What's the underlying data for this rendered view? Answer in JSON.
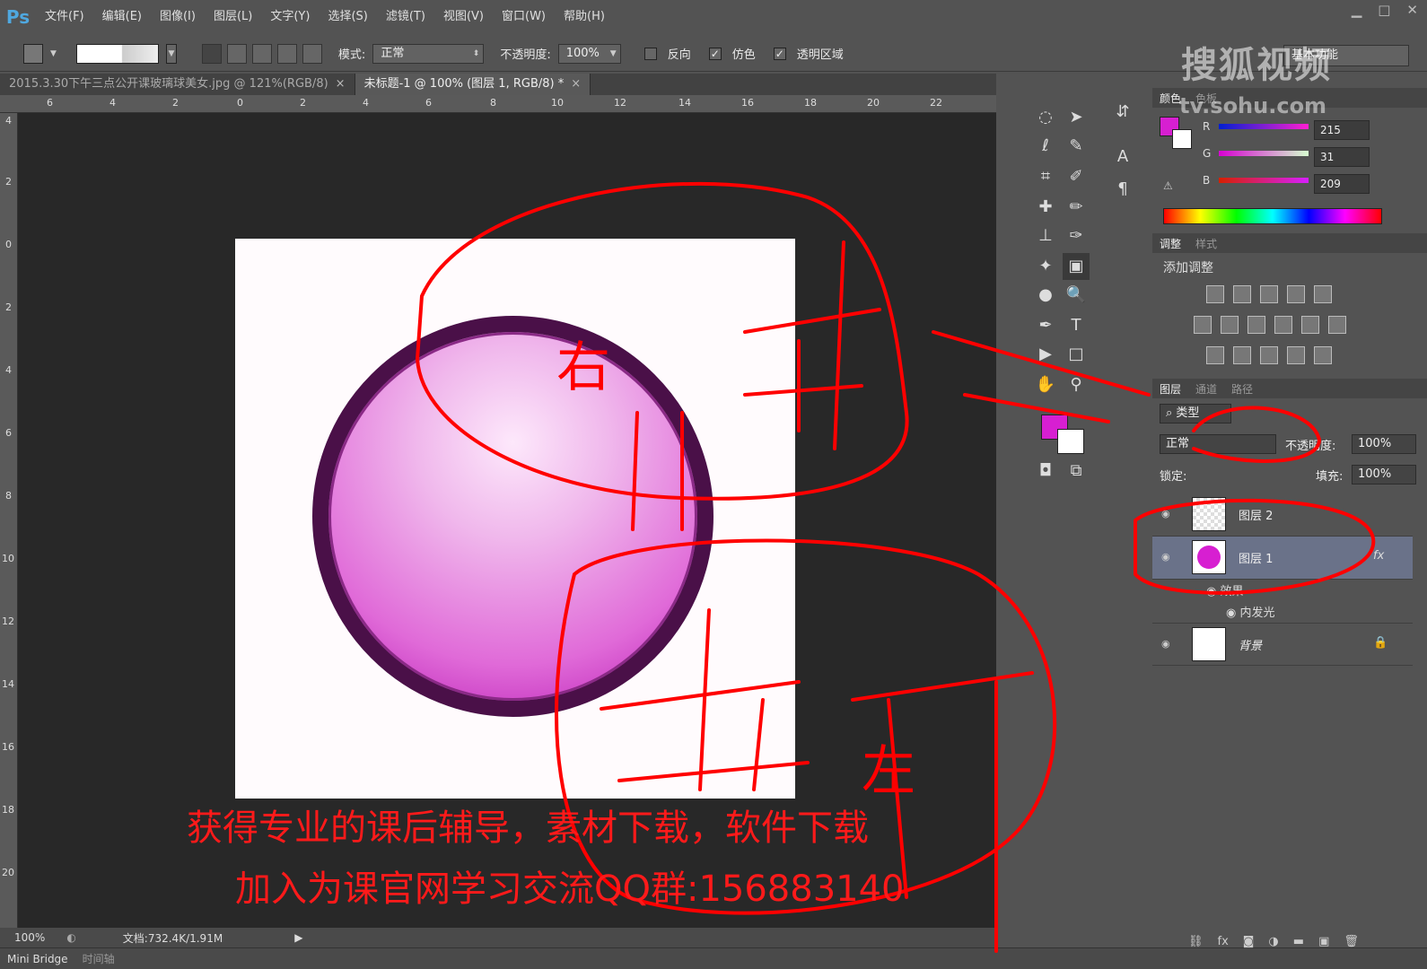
{
  "app": {
    "logo": "Ps"
  },
  "menu": [
    "文件(F)",
    "编辑(E)",
    "图像(I)",
    "图层(L)",
    "文字(Y)",
    "选择(S)",
    "滤镜(T)",
    "视图(V)",
    "窗口(W)",
    "帮助(H)"
  ],
  "options_bar": {
    "mode_label": "模式:",
    "mode_value": "正常",
    "opacity_label": "不透明度:",
    "opacity_value": "100%",
    "reverse_label": "反向",
    "reverse_checked": false,
    "dither_label": "仿色",
    "dither_checked": true,
    "transparency_label": "透明区域",
    "transparency_checked": true,
    "workspace": "基本功能"
  },
  "doc_tabs": [
    {
      "label": "2015.3.30下午三点公开课玻璃球美女.jpg @ 121%(RGB/8)",
      "active": false
    },
    {
      "label": "未标题-1 @ 100% (图层 1, RGB/8) *",
      "active": true
    }
  ],
  "ruler_top": [
    "6",
    "4",
    "2",
    "0",
    "2",
    "4",
    "6",
    "8",
    "10",
    "12",
    "14",
    "16",
    "18",
    "20",
    "22"
  ],
  "ruler_left": [
    "4",
    "2",
    "0",
    "2",
    "4",
    "6",
    "8",
    "10",
    "12",
    "14",
    "16",
    "18",
    "20"
  ],
  "status": {
    "zoom": "100%",
    "doc_size": "文档:732.4K/1.91M"
  },
  "bottom_tabs": [
    "Mini Bridge",
    "时间轴"
  ],
  "color_panel": {
    "tabs": [
      "颜色",
      "色板"
    ],
    "channels": [
      {
        "name": "R",
        "value": "215"
      },
      {
        "name": "G",
        "value": "31"
      },
      {
        "name": "B",
        "value": "209"
      }
    ],
    "foreground": "#d71fd1",
    "background": "#ffffff"
  },
  "adjust_panel": {
    "tabs": [
      "调整",
      "样式"
    ],
    "title": "添加调整"
  },
  "layers_panel": {
    "tabs": [
      "图层",
      "通道",
      "路径"
    ],
    "filter_label": "类型",
    "blend_mode": "正常",
    "opacity_label": "不透明度:",
    "opacity_value": "100%",
    "lock_label": "锁定:",
    "fill_label": "填充:",
    "fill_value": "100%",
    "layers": [
      {
        "name": "图层 2",
        "selected": false
      },
      {
        "name": "图层 1",
        "selected": true,
        "fx": "fx"
      },
      {
        "name": "背景",
        "selected": false
      }
    ],
    "effects_label": "效果",
    "effect_name": "内发光"
  },
  "watermark": {
    "brand": "搜狐视频",
    "url": "tv.sohu.com"
  },
  "overlay_text": {
    "line1": "获得专业的课后辅导，素材下载，软件下载",
    "line2": "加入为课官网学习交流QQ群:156883140"
  },
  "annotation_strokes": {
    "handwritten_1": "右",
    "handwritten_2": "左"
  }
}
